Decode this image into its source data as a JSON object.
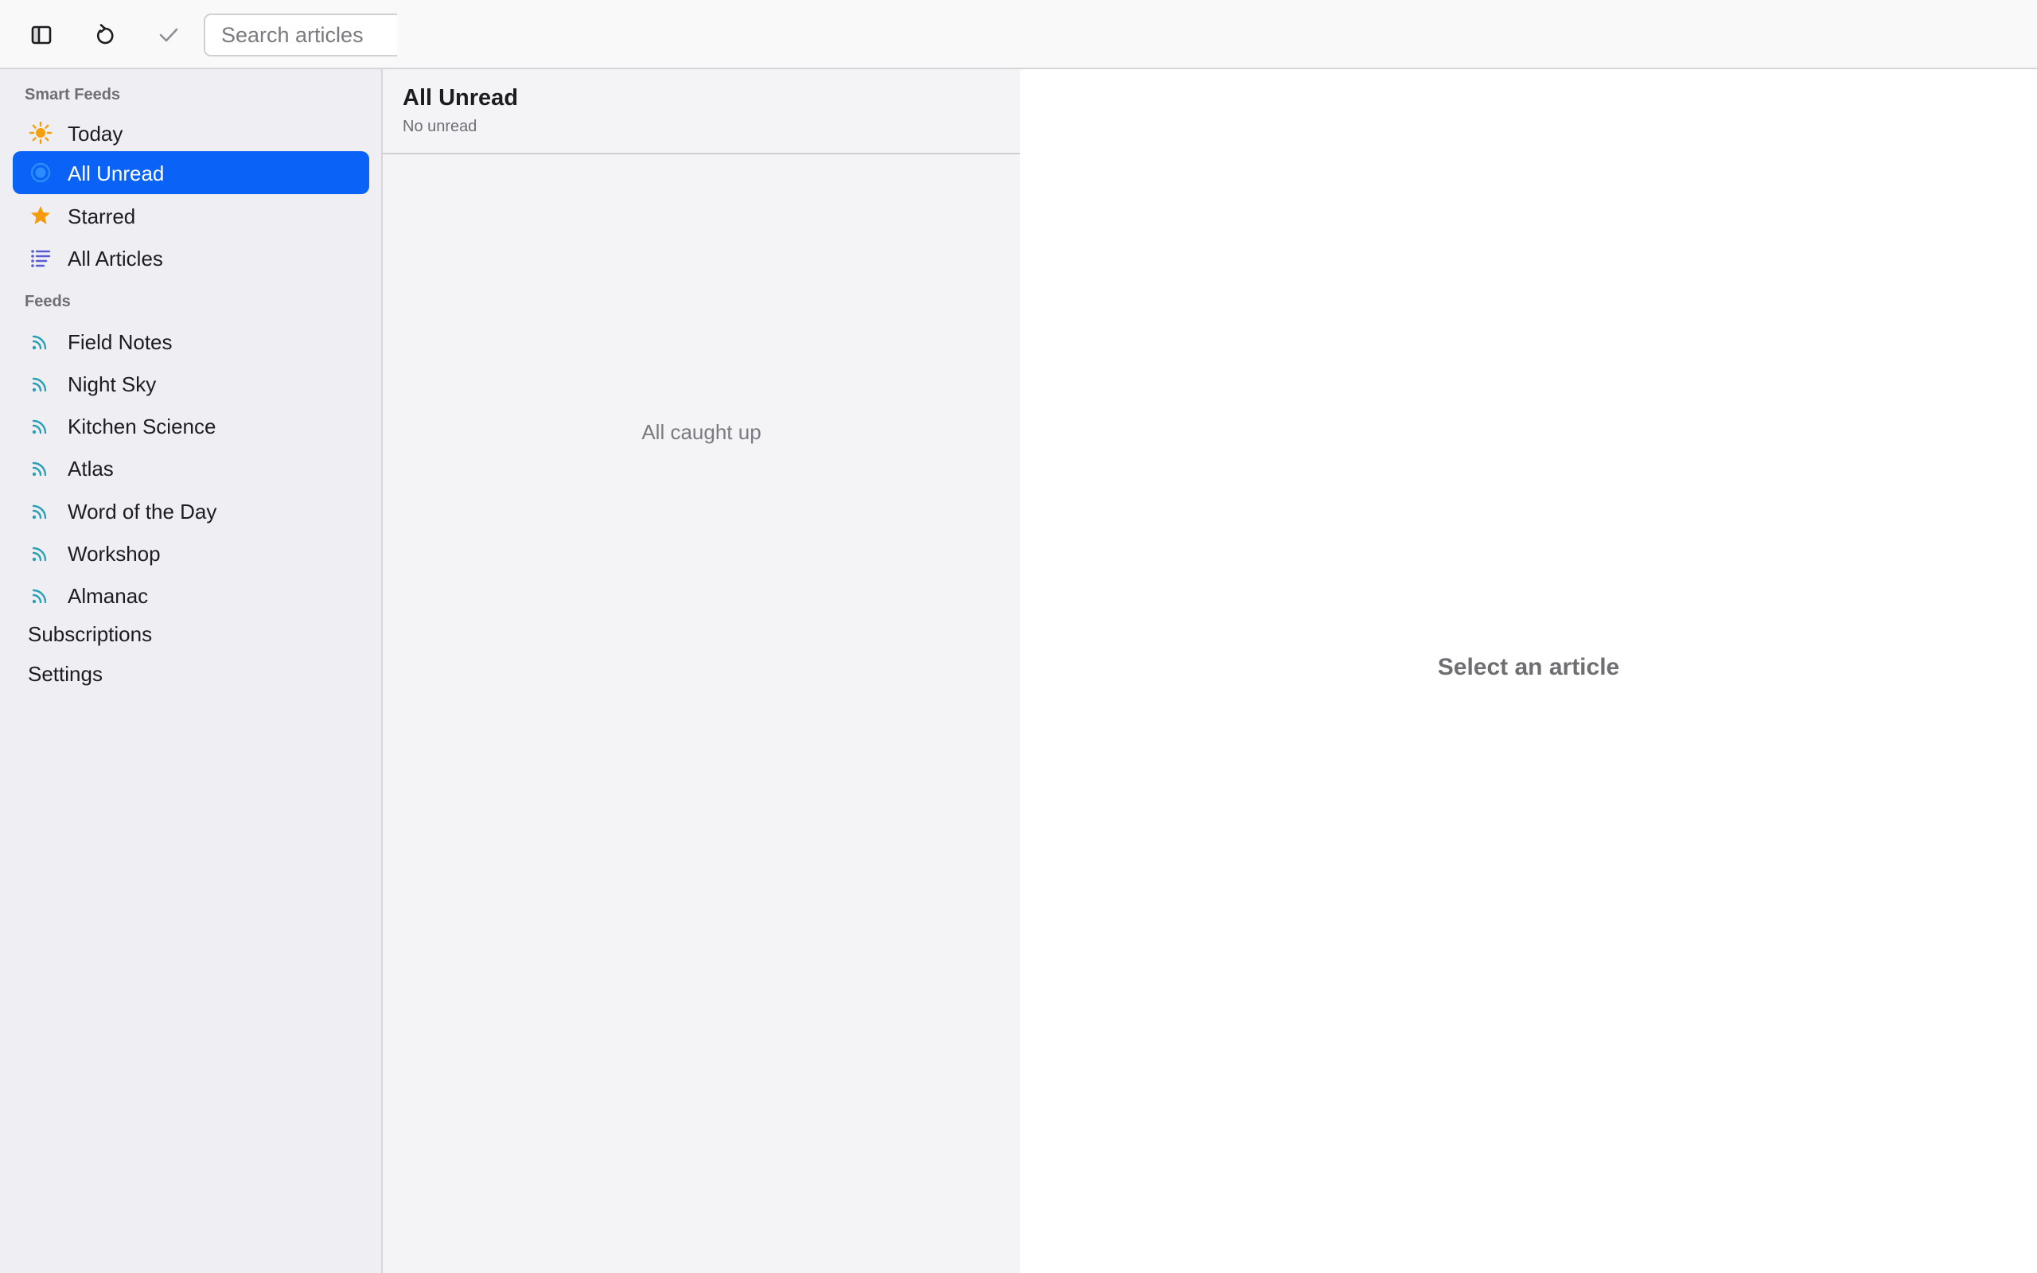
{
  "toolbar": {
    "toggle_sidebar_icon": "sidebar-icon",
    "refresh_icon": "refresh-icon",
    "mark_all_read_icon": "checkmark-icon",
    "search_placeholder": "Search articles",
    "search_value": ""
  },
  "sidebar": {
    "smart_feeds_title": "Smart Feeds",
    "smart_feeds": [
      {
        "label": "Today",
        "icon": "sun-icon",
        "color": "#f5a00a"
      },
      {
        "label": "All Unread",
        "icon": "unread-dot-icon",
        "color": "#1f8bff",
        "selected": true
      },
      {
        "label": "Starred",
        "icon": "star-icon",
        "color": "#f59a0b"
      },
      {
        "label": "All Articles",
        "icon": "list-icon",
        "color": "#5a5ad6"
      }
    ],
    "feeds_title": "Feeds",
    "feeds": [
      {
        "label": "Field Notes",
        "icon": "rss-icon"
      },
      {
        "label": "Night Sky",
        "icon": "rss-icon"
      },
      {
        "label": "Kitchen Science",
        "icon": "rss-icon"
      },
      {
        "label": "Atlas",
        "icon": "rss-icon"
      },
      {
        "label": "Word of the Day",
        "icon": "rss-icon"
      },
      {
        "label": "Workshop",
        "icon": "rss-icon"
      },
      {
        "label": "Almanac",
        "icon": "rss-icon"
      }
    ],
    "feed_icon_color": "#2a9fb8",
    "subscriptions_label": "Subscriptions",
    "settings_label": "Settings"
  },
  "article_list": {
    "title": "All Unread",
    "subtitle": "No unread",
    "empty_message": "All caught up"
  },
  "reader": {
    "empty_message": "Select an article"
  },
  "colors": {
    "accent": "#0a63f6",
    "sidebar_bg": "#efeff3",
    "list_bg": "#f4f4f7"
  }
}
